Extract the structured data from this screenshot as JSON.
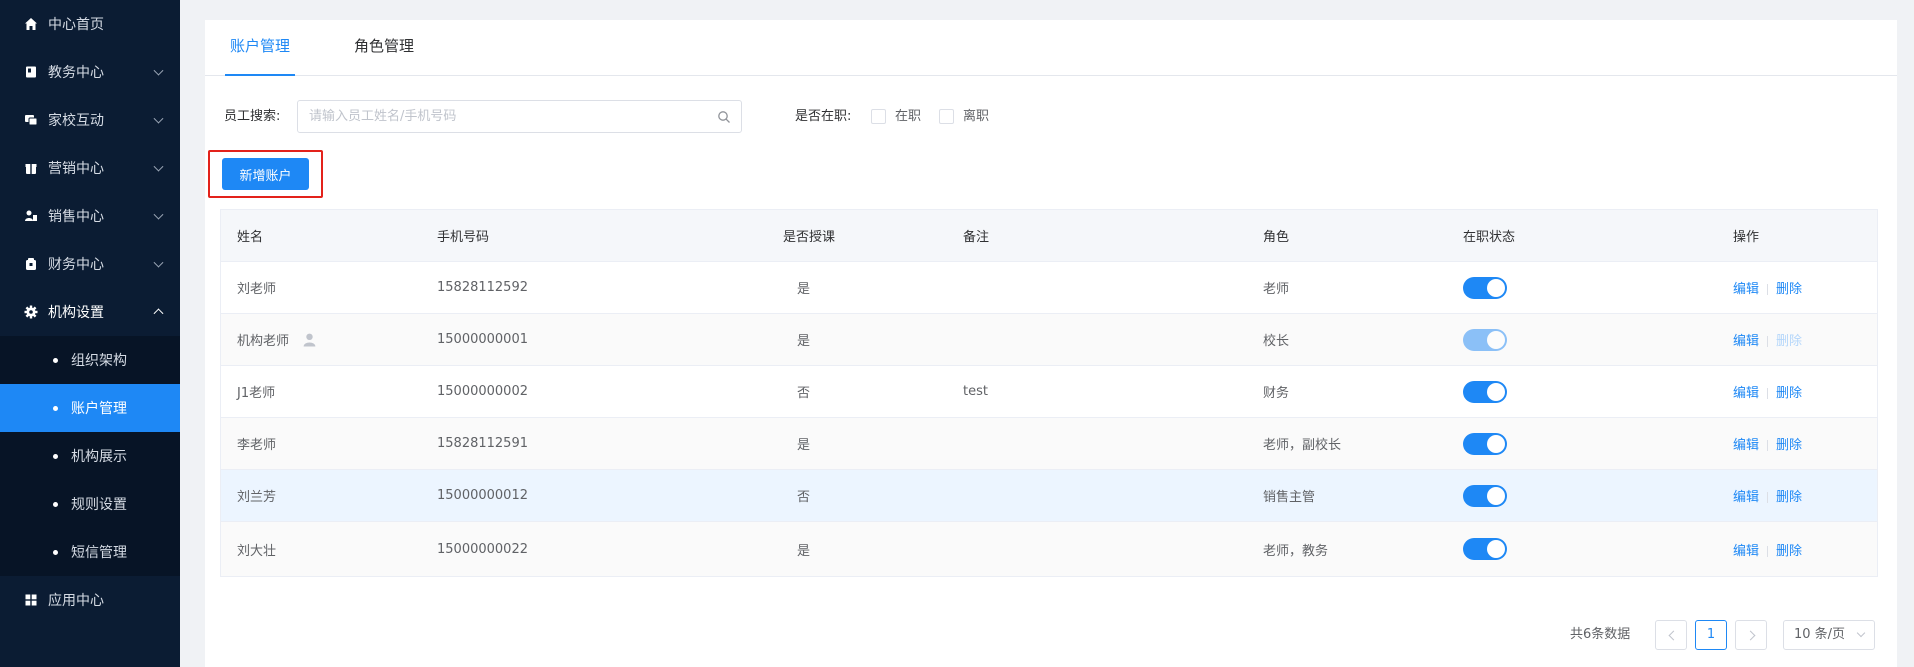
{
  "sidebar": {
    "items": [
      {
        "label": "中心首页",
        "icon": "home-icon",
        "has_children": false
      },
      {
        "label": "教务中心",
        "icon": "book-icon",
        "has_children": true
      },
      {
        "label": "家校互动",
        "icon": "chat-icon",
        "has_children": true
      },
      {
        "label": "营销中心",
        "icon": "gift-icon",
        "has_children": true
      },
      {
        "label": "销售中心",
        "icon": "users-icon",
        "has_children": true
      },
      {
        "label": "财务中心",
        "icon": "wallet-icon",
        "has_children": true
      },
      {
        "label": "机构设置",
        "icon": "gear-icon",
        "has_children": true,
        "open": true
      }
    ],
    "sub_items": [
      {
        "label": "组织架构"
      },
      {
        "label": "账户管理",
        "active": true
      },
      {
        "label": "机构展示"
      },
      {
        "label": "规则设置"
      },
      {
        "label": "短信管理"
      }
    ],
    "last_item": {
      "label": "应用中心",
      "icon": "grid-icon"
    },
    "colors": {
      "background": "#0b1c33",
      "active": "#1e88f5"
    }
  },
  "tabs": [
    {
      "label": "账户管理",
      "active": true
    },
    {
      "label": "角色管理",
      "active": false
    }
  ],
  "filters": {
    "search_label": "员工搜索:",
    "search_placeholder": "请输入员工姓名/手机号码",
    "employed_label": "是否在职:",
    "options": [
      "在职",
      "离职"
    ]
  },
  "add_button": "新增账户",
  "table": {
    "headers": [
      "姓名",
      "手机号码",
      "是否授课",
      "备注",
      "角色",
      "在职状态",
      "操作"
    ],
    "rows": [
      {
        "name": "刘老师",
        "phone": "15828112592",
        "teaches": "是",
        "note": "",
        "role": "老师",
        "active": true,
        "disabled": false
      },
      {
        "name": "机构老师",
        "phone": "15000000001",
        "teaches": "是",
        "note": "",
        "role": "校长",
        "active": true,
        "disabled": true
      },
      {
        "name": "J1老师",
        "phone": "15000000002",
        "teaches": "否",
        "note": "test",
        "role": "财务",
        "active": true,
        "disabled": false
      },
      {
        "name": "李老师",
        "phone": "15828112591",
        "teaches": "是",
        "note": "",
        "role": "老师，副校长",
        "active": true,
        "disabled": false
      },
      {
        "name": "刘兰芳",
        "phone": "15000000012",
        "teaches": "否",
        "note": "",
        "role": "销售主管",
        "active": true,
        "disabled": false
      },
      {
        "name": "刘大壮",
        "phone": "15000000022",
        "teaches": "是",
        "note": "",
        "role": "老师，教务",
        "active": true,
        "disabled": false
      }
    ],
    "edit_label": "编辑",
    "delete_label": "删除"
  },
  "pagination": {
    "total": "共6条数据",
    "current_page": "1",
    "page_size": "10 条/页"
  },
  "accent_color": "#1e88f5"
}
